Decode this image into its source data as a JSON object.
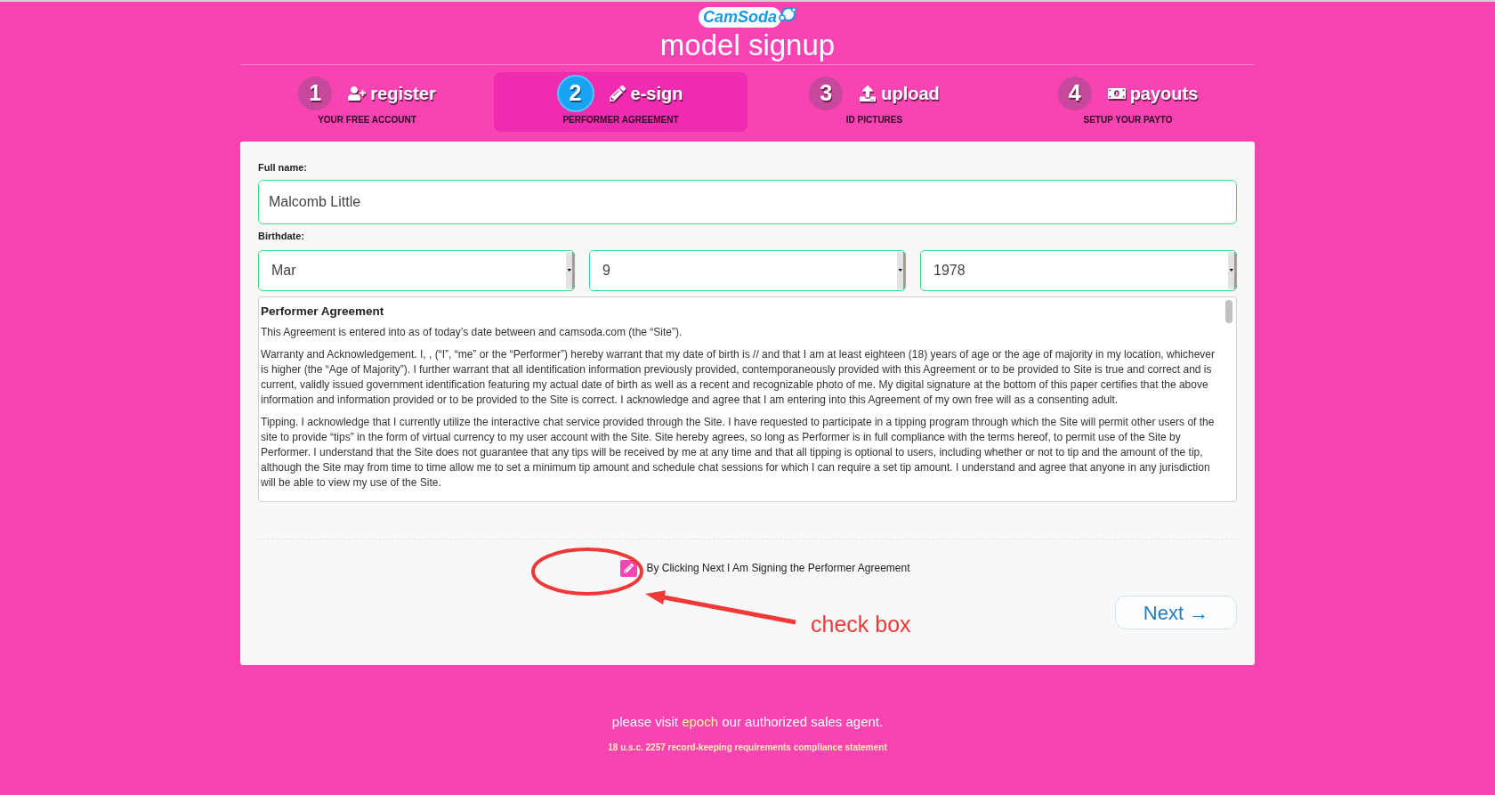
{
  "logo": "CamSoda",
  "title": "model signup",
  "steps": [
    {
      "number": "1",
      "label": "register",
      "sublabel": "YOUR FREE ACCOUNT",
      "selected": false
    },
    {
      "number": "2",
      "label": "e-sign",
      "sublabel": "PERFORMER AGREEMENT",
      "selected": true
    },
    {
      "number": "3",
      "label": "upload",
      "sublabel": "ID PICTURES",
      "selected": false
    },
    {
      "number": "4",
      "label": "payouts",
      "sublabel": "SETUP YOUR PAYTO",
      "selected": false
    }
  ],
  "form": {
    "full_name": {
      "label": "Full name:",
      "value": "Malcomb Little"
    },
    "birthdate": {
      "label": "Birthdate:",
      "selects": [
        {
          "value": "Mar"
        },
        {
          "value": "9"
        },
        {
          "value": "1978"
        }
      ]
    },
    "agreement": {
      "title": "Performer Agreement",
      "paragraphs": [
        "This Agreement is entered into as of today’s date between and camsoda.com (the “Site”).",
        "Warranty and Acknowledgement. I, , (“I”, “me” or the “Performer”) hereby warrant that my date of birth is // and that I am at least eighteen (18) years of age or the age of majority in my location, whichever is higher (the “Age of Majority”). I further warrant that all identification information previously provided, contemporaneously provided with this Agreement or to be provided to Site is true and correct and is current, validly issued government identification featuring my actual date of birth as well as a recent and recognizable photo of me. My digital signature at the bottom of this paper certifies that the above information and information provided or to be provided to the Site is correct. I acknowledge and agree that I am entering into this Agreement of my own free will as a consenting adult.",
        "Tipping. I acknowledge that I currently utilize the interactive chat service provided through the Site. I have requested to participate in a tipping program through which the Site will permit other users of the site to provide “tips” in the form of virtual currency to my user account with the Site. Site hereby agrees, so long as Performer is in full compliance with the terms hereof, to permit use of the Site by Performer. I understand that the Site does not guarantee that any tips will be received by me at any time and that all tipping is optional to users, including whether or not to tip and the amount of the tip, although the Site may from time to time allow me to set a minimum tip amount and schedule chat sessions for which I can require a set tip amount. I understand and agree that anyone in any jurisdiction will be able to view my use of the Site."
      ]
    },
    "signature_checkbox": {
      "label": "By Clicking Next I Am Signing the Performer Agreement",
      "checked": true
    },
    "next_button": "Next →"
  },
  "annotation": {
    "text": "check box"
  },
  "footer": {
    "text_before": "please visit",
    "link": "epoch",
    "text_after": "our authorized sales agent.",
    "compliance_link": "18 u.s.c. 2257 record-keeping requirements compliance statement"
  }
}
